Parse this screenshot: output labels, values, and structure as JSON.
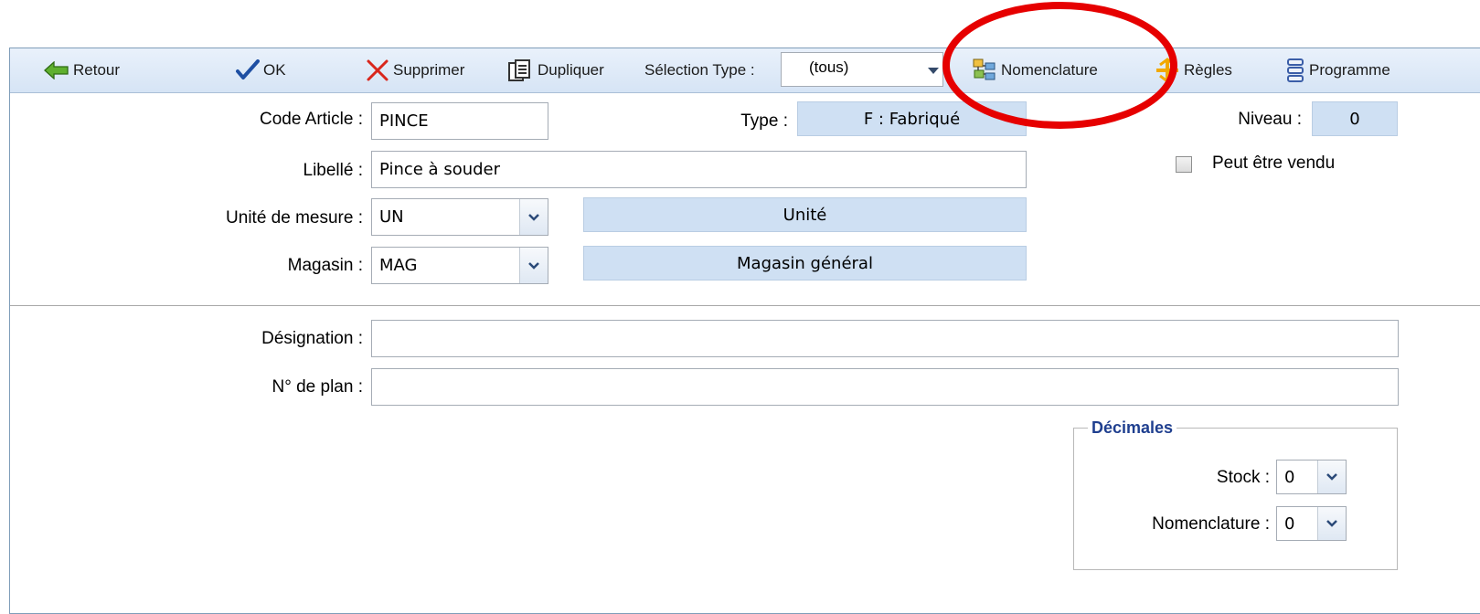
{
  "toolbar": {
    "back_label": "Retour",
    "ok_label": "OK",
    "delete_label": "Supprimer",
    "duplicate_label": "Dupliquer",
    "type_selection_label": "Sélection Type :",
    "type_selection_value": "(tous)",
    "bom_label": "Nomenclature",
    "rules_label": "Règles",
    "program_label": "Programme",
    "colors": {
      "bar_top": "#e9f1fb",
      "bar_bottom": "#d6e4f5"
    },
    "icons": [
      "arrow-left-icon",
      "check-icon",
      "x-icon",
      "duplicate-icon",
      "nomenclature-icon",
      "rules-icon",
      "program-icon"
    ]
  },
  "form": {
    "code_article": {
      "label": "Code Article :",
      "value": "PINCE"
    },
    "type": {
      "label": "Type :",
      "value": "F : Fabriqué"
    },
    "niveau": {
      "label": "Niveau :",
      "value": "0"
    },
    "can_be_sold": {
      "label": "Peut être vendu",
      "checked": false
    },
    "libelle": {
      "label": "Libellé :",
      "value": "Pince à souder"
    },
    "unite": {
      "label": "Unité de mesure :",
      "value": "UN",
      "description": "Unité"
    },
    "magasin": {
      "label": "Magasin :",
      "value": "MAG",
      "description": "Magasin général"
    },
    "designation": {
      "label": "Désignation :",
      "value": ""
    },
    "plan": {
      "label": "N° de plan :",
      "value": ""
    }
  },
  "decimals": {
    "legend": "Décimales",
    "stock": {
      "label": "Stock :",
      "value": "0"
    },
    "nomenclature": {
      "label": "Nomenclature :",
      "value": "0"
    }
  },
  "annotation": {
    "color": "#e60000"
  }
}
